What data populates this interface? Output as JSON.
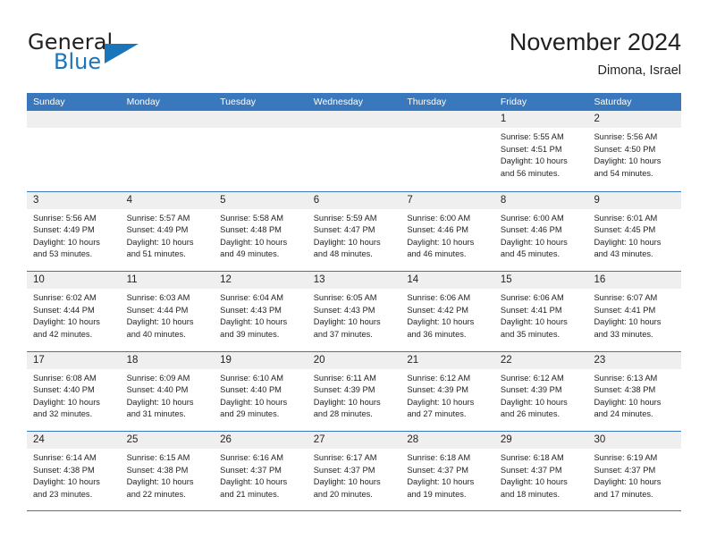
{
  "brand": {
    "name_part1": "General",
    "name_part2": "Blue",
    "triangle_color": "#1b75bb"
  },
  "header": {
    "month_title": "November 2024",
    "location": "Dimona, Israel"
  },
  "theme": {
    "header_blue": "#3a78bd",
    "day_number_bg": "#efefef",
    "text": "#231f20"
  },
  "calendar": {
    "weekday_headers": [
      "Sunday",
      "Monday",
      "Tuesday",
      "Wednesday",
      "Thursday",
      "Friday",
      "Saturday"
    ],
    "weeks": [
      [
        {
          "day": "",
          "empty": true
        },
        {
          "day": "",
          "empty": true
        },
        {
          "day": "",
          "empty": true
        },
        {
          "day": "",
          "empty": true
        },
        {
          "day": "",
          "empty": true
        },
        {
          "day": "1",
          "sunrise": "Sunrise: 5:55 AM",
          "sunset": "Sunset: 4:51 PM",
          "daylight_line1": "Daylight: 10 hours",
          "daylight_line2": "and 56 minutes."
        },
        {
          "day": "2",
          "sunrise": "Sunrise: 5:56 AM",
          "sunset": "Sunset: 4:50 PM",
          "daylight_line1": "Daylight: 10 hours",
          "daylight_line2": "and 54 minutes."
        }
      ],
      [
        {
          "day": "3",
          "sunrise": "Sunrise: 5:56 AM",
          "sunset": "Sunset: 4:49 PM",
          "daylight_line1": "Daylight: 10 hours",
          "daylight_line2": "and 53 minutes."
        },
        {
          "day": "4",
          "sunrise": "Sunrise: 5:57 AM",
          "sunset": "Sunset: 4:49 PM",
          "daylight_line1": "Daylight: 10 hours",
          "daylight_line2": "and 51 minutes."
        },
        {
          "day": "5",
          "sunrise": "Sunrise: 5:58 AM",
          "sunset": "Sunset: 4:48 PM",
          "daylight_line1": "Daylight: 10 hours",
          "daylight_line2": "and 49 minutes."
        },
        {
          "day": "6",
          "sunrise": "Sunrise: 5:59 AM",
          "sunset": "Sunset: 4:47 PM",
          "daylight_line1": "Daylight: 10 hours",
          "daylight_line2": "and 48 minutes."
        },
        {
          "day": "7",
          "sunrise": "Sunrise: 6:00 AM",
          "sunset": "Sunset: 4:46 PM",
          "daylight_line1": "Daylight: 10 hours",
          "daylight_line2": "and 46 minutes."
        },
        {
          "day": "8",
          "sunrise": "Sunrise: 6:00 AM",
          "sunset": "Sunset: 4:46 PM",
          "daylight_line1": "Daylight: 10 hours",
          "daylight_line2": "and 45 minutes."
        },
        {
          "day": "9",
          "sunrise": "Sunrise: 6:01 AM",
          "sunset": "Sunset: 4:45 PM",
          "daylight_line1": "Daylight: 10 hours",
          "daylight_line2": "and 43 minutes."
        }
      ],
      [
        {
          "day": "10",
          "sunrise": "Sunrise: 6:02 AM",
          "sunset": "Sunset: 4:44 PM",
          "daylight_line1": "Daylight: 10 hours",
          "daylight_line2": "and 42 minutes."
        },
        {
          "day": "11",
          "sunrise": "Sunrise: 6:03 AM",
          "sunset": "Sunset: 4:44 PM",
          "daylight_line1": "Daylight: 10 hours",
          "daylight_line2": "and 40 minutes."
        },
        {
          "day": "12",
          "sunrise": "Sunrise: 6:04 AM",
          "sunset": "Sunset: 4:43 PM",
          "daylight_line1": "Daylight: 10 hours",
          "daylight_line2": "and 39 minutes."
        },
        {
          "day": "13",
          "sunrise": "Sunrise: 6:05 AM",
          "sunset": "Sunset: 4:43 PM",
          "daylight_line1": "Daylight: 10 hours",
          "daylight_line2": "and 37 minutes."
        },
        {
          "day": "14",
          "sunrise": "Sunrise: 6:06 AM",
          "sunset": "Sunset: 4:42 PM",
          "daylight_line1": "Daylight: 10 hours",
          "daylight_line2": "and 36 minutes."
        },
        {
          "day": "15",
          "sunrise": "Sunrise: 6:06 AM",
          "sunset": "Sunset: 4:41 PM",
          "daylight_line1": "Daylight: 10 hours",
          "daylight_line2": "and 35 minutes."
        },
        {
          "day": "16",
          "sunrise": "Sunrise: 6:07 AM",
          "sunset": "Sunset: 4:41 PM",
          "daylight_line1": "Daylight: 10 hours",
          "daylight_line2": "and 33 minutes."
        }
      ],
      [
        {
          "day": "17",
          "sunrise": "Sunrise: 6:08 AM",
          "sunset": "Sunset: 4:40 PM",
          "daylight_line1": "Daylight: 10 hours",
          "daylight_line2": "and 32 minutes."
        },
        {
          "day": "18",
          "sunrise": "Sunrise: 6:09 AM",
          "sunset": "Sunset: 4:40 PM",
          "daylight_line1": "Daylight: 10 hours",
          "daylight_line2": "and 31 minutes."
        },
        {
          "day": "19",
          "sunrise": "Sunrise: 6:10 AM",
          "sunset": "Sunset: 4:40 PM",
          "daylight_line1": "Daylight: 10 hours",
          "daylight_line2": "and 29 minutes."
        },
        {
          "day": "20",
          "sunrise": "Sunrise: 6:11 AM",
          "sunset": "Sunset: 4:39 PM",
          "daylight_line1": "Daylight: 10 hours",
          "daylight_line2": "and 28 minutes."
        },
        {
          "day": "21",
          "sunrise": "Sunrise: 6:12 AM",
          "sunset": "Sunset: 4:39 PM",
          "daylight_line1": "Daylight: 10 hours",
          "daylight_line2": "and 27 minutes."
        },
        {
          "day": "22",
          "sunrise": "Sunrise: 6:12 AM",
          "sunset": "Sunset: 4:39 PM",
          "daylight_line1": "Daylight: 10 hours",
          "daylight_line2": "and 26 minutes."
        },
        {
          "day": "23",
          "sunrise": "Sunrise: 6:13 AM",
          "sunset": "Sunset: 4:38 PM",
          "daylight_line1": "Daylight: 10 hours",
          "daylight_line2": "and 24 minutes."
        }
      ],
      [
        {
          "day": "24",
          "sunrise": "Sunrise: 6:14 AM",
          "sunset": "Sunset: 4:38 PM",
          "daylight_line1": "Daylight: 10 hours",
          "daylight_line2": "and 23 minutes."
        },
        {
          "day": "25",
          "sunrise": "Sunrise: 6:15 AM",
          "sunset": "Sunset: 4:38 PM",
          "daylight_line1": "Daylight: 10 hours",
          "daylight_line2": "and 22 minutes."
        },
        {
          "day": "26",
          "sunrise": "Sunrise: 6:16 AM",
          "sunset": "Sunset: 4:37 PM",
          "daylight_line1": "Daylight: 10 hours",
          "daylight_line2": "and 21 minutes."
        },
        {
          "day": "27",
          "sunrise": "Sunrise: 6:17 AM",
          "sunset": "Sunset: 4:37 PM",
          "daylight_line1": "Daylight: 10 hours",
          "daylight_line2": "and 20 minutes."
        },
        {
          "day": "28",
          "sunrise": "Sunrise: 6:18 AM",
          "sunset": "Sunset: 4:37 PM",
          "daylight_line1": "Daylight: 10 hours",
          "daylight_line2": "and 19 minutes."
        },
        {
          "day": "29",
          "sunrise": "Sunrise: 6:18 AM",
          "sunset": "Sunset: 4:37 PM",
          "daylight_line1": "Daylight: 10 hours",
          "daylight_line2": "and 18 minutes."
        },
        {
          "day": "30",
          "sunrise": "Sunrise: 6:19 AM",
          "sunset": "Sunset: 4:37 PM",
          "daylight_line1": "Daylight: 10 hours",
          "daylight_line2": "and 17 minutes."
        }
      ]
    ]
  }
}
